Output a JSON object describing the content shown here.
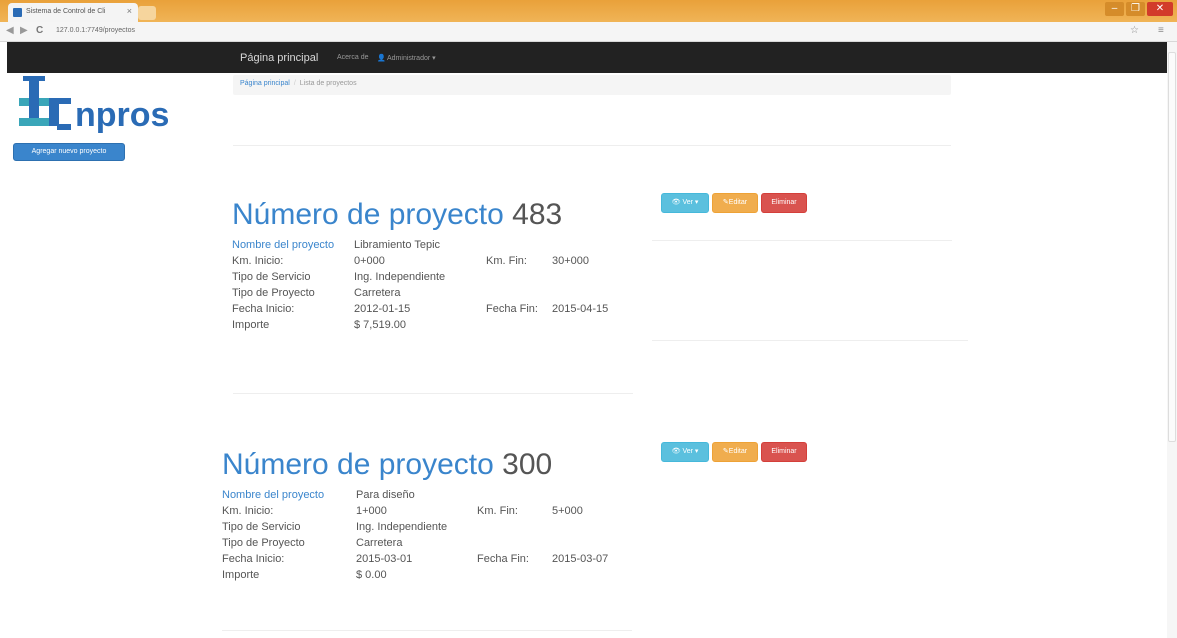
{
  "browser": {
    "tab_title": "Sistema de Control de Cli",
    "tab_close": "×",
    "url": "127.0.0.1:7749/proyectos",
    "back": "◀",
    "forward": "▶",
    "reload": "C",
    "star_icon": "☆",
    "menu_icon": "≡",
    "window_min": "–",
    "window_max": "❐",
    "window_close": "✕"
  },
  "navbar": {
    "brand": "Página principal",
    "about": "Acerca de",
    "user": "Administrador ▾"
  },
  "sidebar": {
    "add_button": "Agregar nuevo proyecto"
  },
  "breadcrumb": {
    "home": "Página principal",
    "current": "Lista de proyectos"
  },
  "labels": {
    "title_prefix": "Número de proyecto",
    "nombre": "Nombre del proyecto",
    "km_inicio": "Km. Inicio:",
    "km_fin": "Km. Fin:",
    "tipo_servicio": "Tipo de Servicio",
    "tipo_proyecto": "Tipo de Proyecto",
    "fecha_inicio": "Fecha Inicio:",
    "fecha_fin": "Fecha Fin:",
    "importe": "Importe"
  },
  "actions": {
    "view": "Ver ▾",
    "edit": "Editar",
    "delete": "Eliminar"
  },
  "projects": [
    {
      "number": "483",
      "nombre": "Libramiento Tepic",
      "km_inicio": "0+000",
      "km_fin": "30+000",
      "tipo_servicio": "Ing. Independiente",
      "tipo_proyecto": "Carretera",
      "fecha_inicio": "2012-01-15",
      "fecha_fin": "2015-04-15",
      "importe": "$ 7,519.00"
    },
    {
      "number": "300",
      "nombre": "Para diseño",
      "km_inicio": "1+000",
      "km_fin": "5+000",
      "tipo_servicio": "Ing. Independiente",
      "tipo_proyecto": "Carretera",
      "fecha_inicio": "2015-03-01",
      "fecha_fin": "2015-03-07",
      "importe": "$ 0.00"
    }
  ],
  "colors": {
    "accent": "#3a85cc",
    "navbar": "#222222",
    "btn_view": "#5bc0de",
    "btn_edit": "#f0ad4e",
    "btn_delete": "#d9534f",
    "logo_blue": "#2a6bb5",
    "logo_teal": "#3aa6b9"
  },
  "logo": {
    "text": "npros"
  }
}
